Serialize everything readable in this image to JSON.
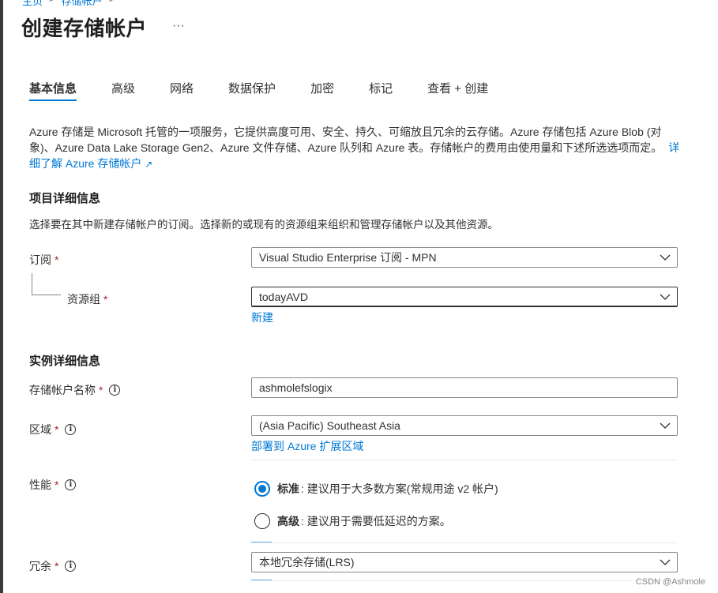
{
  "breadcrumb": {
    "home": "主页",
    "parent": "存储帐户",
    "sep": ">"
  },
  "page": {
    "title": "创建存储帐户",
    "more": "···"
  },
  "tabs": [
    {
      "label": "基本信息"
    },
    {
      "label": "高级"
    },
    {
      "label": "网络"
    },
    {
      "label": "数据保护"
    },
    {
      "label": "加密"
    },
    {
      "label": "标记"
    },
    {
      "label": "查看 + 创建"
    }
  ],
  "intro": {
    "text": "Azure 存储是 Microsoft 托管的一项服务，它提供高度可用、安全、持久、可缩放且冗余的云存储。Azure 存储包括 Azure Blob (对象)、Azure Data Lake Storage Gen2、Azure 文件存储、Azure 队列和 Azure 表。存储帐户的费用由使用量和下述所选选项而定。",
    "link": "详细了解 Azure 存储帐户"
  },
  "project": {
    "title": "项目详细信息",
    "desc": "选择要在其中新建存储帐户的订阅。选择新的或现有的资源组来组织和管理存储帐户以及其他资源。",
    "subscription_label": "订阅",
    "subscription_value": "Visual Studio Enterprise 订阅 - MPN",
    "rg_label": "资源组",
    "rg_value": "todayAVD",
    "new_link": "新建"
  },
  "instance": {
    "title": "实例详细信息",
    "name_label": "存储帐户名称",
    "name_value": "ashmolefslogix",
    "region_label": "区域",
    "region_value": "(Asia Pacific) Southeast Asia",
    "deploy_link": "部署到 Azure 扩展区域",
    "perf_label": "性能",
    "perf_standard_bold": "标准",
    "perf_standard_rest": ": 建议用于大多数方案(常规用途 v2 帐户)",
    "perf_premium_bold": "高级",
    "perf_premium_rest": ": 建议用于需要低延迟的方案。",
    "redundancy_label": "冗余",
    "redundancy_value": "本地冗余存储(LRS)"
  },
  "required_mark": "*",
  "info_glyph": "i",
  "watermark": "CSDN @Ashmole",
  "colors": {
    "accent": "#0078d4",
    "required": "#a4262c",
    "text": "#323130"
  }
}
